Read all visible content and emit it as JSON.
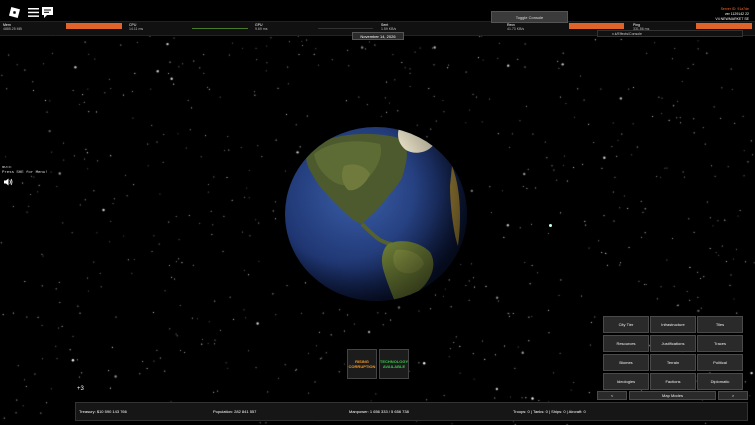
{
  "top_metrics": [
    {
      "name": "Mem",
      "value": "4885.25 MB"
    },
    {
      "name": "CPU",
      "value": "14.11 ms"
    },
    {
      "name": "GPU",
      "value": "9.69 ms"
    },
    {
      "name": "Sent",
      "value": "1.59 KB/s"
    },
    {
      "name": "Recv",
      "value": "41.73 KB/s"
    },
    {
      "name": "Ping",
      "value": "331.86 ms"
    }
  ],
  "toggle_console_label": "Toggle Console",
  "date_label": "November 14, 2026",
  "server": {
    "id_label": "Server ID: 91a7de",
    "version": "ver 1129142 22",
    "region": "V4 NEWMARKET SE"
  },
  "console_field_text": "x.k/Effects/Console",
  "note_lines": [
    "NOTE",
    "Press SHE for Menu!"
  ],
  "alerts": [
    {
      "label": "RISING CORRUPTION",
      "color": "#f59a23"
    },
    {
      "label": "TECHNOLOGY AVAILABLE",
      "color": "#35c94a"
    }
  ],
  "plus_counter": "+3",
  "bottom_stats": {
    "treasury": "Treasury:  $10 590 143 766",
    "population": "Population: 282 841 557",
    "manpower": "Manpower:  1 656 333  /  5 656 738",
    "military": "Troops: 0  |  Tanks: 0  |  Ships: 0  |  Aircraft: 0"
  },
  "map_modes": [
    "City Tier",
    "Infrastructure",
    "Tiles",
    "Resources",
    "Justifications",
    "Traces",
    "Biomes",
    "Terrain",
    "Political",
    "Ideologies",
    "Factions",
    "Diplomatic"
  ],
  "nav": {
    "prev": "<",
    "label": "Map Modes",
    "next": ">"
  },
  "colors": {
    "perf_bar_orange": "#e0632a",
    "rising_corruption": "#f59a23",
    "technology_available": "#35c94a",
    "server_id": "#ff6a2a"
  },
  "icons": [
    "roblox-logo-icon",
    "hamburger-menu-icon",
    "chat-icon",
    "speaker-icon"
  ]
}
